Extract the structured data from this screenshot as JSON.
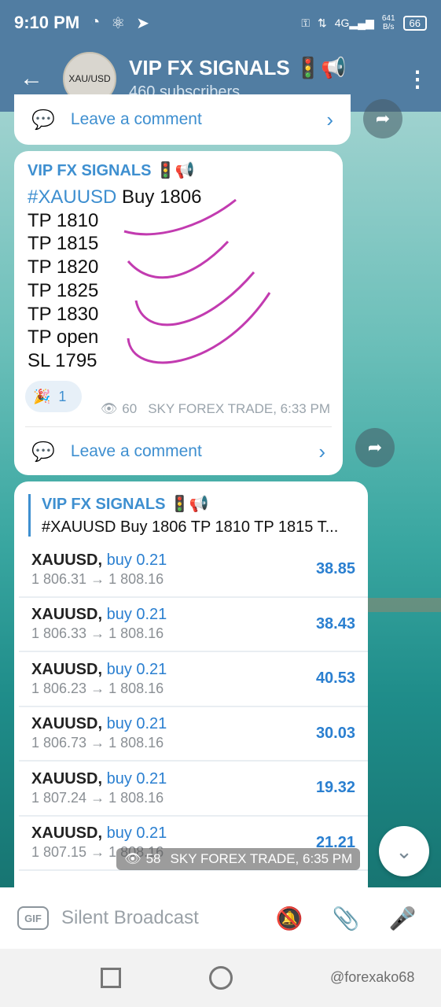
{
  "status": {
    "time": "9:10 PM",
    "network": "4G",
    "speed_value": "641",
    "speed_unit": "B/s",
    "battery": "66"
  },
  "header": {
    "avatar_text": "XAU/USD",
    "title": "VIP FX SIGNALS 🚦📢",
    "subtitle": "460 subscribers"
  },
  "top_card": {
    "comment_label": "Leave a comment"
  },
  "message": {
    "channel": "VIP FX SIGNALS 🚦📢",
    "tag": "#XAUUSD",
    "first_line_rest": " Buy 1806",
    "lines": [
      "TP 1810",
      "TP 1815",
      "TP 1820",
      "TP 1825",
      "TP 1830",
      "TP open",
      "SL 1795"
    ],
    "reaction_emoji": "🎉",
    "reaction_count": "1",
    "views": "60",
    "signature": "SKY FOREX TRADE, 6:33 PM",
    "comment_label": "Leave a comment"
  },
  "trade_post": {
    "reply_name": "VIP FX SIGNALS 🚦📢",
    "reply_text": "#XAUUSD Buy 1806 TP 1810 TP 1815 T...",
    "trades": [
      {
        "symbol": "XAUUSD,",
        "direction": "buy 0.21",
        "prices": "1 806.31 → 1 808.16",
        "profit": "38.85"
      },
      {
        "symbol": "XAUUSD,",
        "direction": "buy 0.21",
        "prices": "1 806.33 → 1 808.16",
        "profit": "38.43"
      },
      {
        "symbol": "XAUUSD,",
        "direction": "buy 0.21",
        "prices": "1 806.23 → 1 808.16",
        "profit": "40.53"
      },
      {
        "symbol": "XAUUSD,",
        "direction": "buy 0.21",
        "prices": "1 806.73 → 1 808.16",
        "profit": "30.03"
      },
      {
        "symbol": "XAUUSD,",
        "direction": "buy 0.21",
        "prices": "1 807.24 → 1 808.16",
        "profit": "19.32"
      },
      {
        "symbol": "XAUUSD,",
        "direction": "buy 0.21",
        "prices": "1 807.15 → 1 808.16",
        "profit": "21.21"
      }
    ],
    "views": "58",
    "signature": "SKY FOREX TRADE, 6:35 PM"
  },
  "input": {
    "gif_label": "GIF",
    "placeholder": "Silent Broadcast"
  },
  "watermark": "@forexako68",
  "colors": {
    "header_bg": "#517da2",
    "link_blue": "#3e8fd0",
    "annotation_magenta": "#c23bb0"
  },
  "icons": {
    "back": "arrow-left",
    "menu": "more-vertical",
    "comment": "chat-bubble",
    "share": "share-arrow",
    "views": "eye",
    "mute": "bell-off",
    "attach": "paperclip",
    "mic": "microphone",
    "scroll": "chevron-down"
  }
}
